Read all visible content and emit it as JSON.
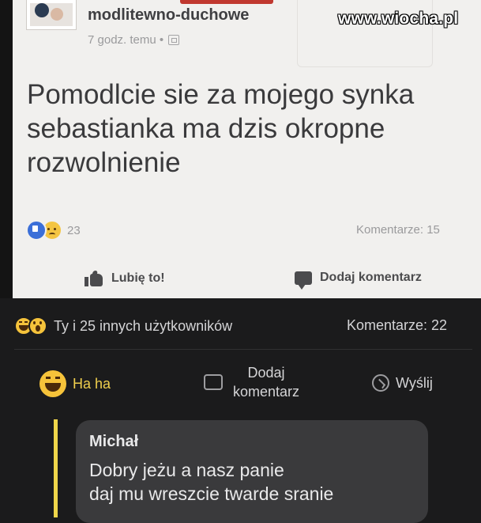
{
  "watermark": "www.wiocha.pl",
  "post": {
    "page_name": "modlitewno-duchowe",
    "time": "7 godz. temu •",
    "text": "Pomodlcie sie za mojego synka sebastianka ma dzis okropne rozwolnienie",
    "reaction_count": "23",
    "comments": "Komentarze: 15",
    "actions": {
      "like": "Lubię to!",
      "comment": "Dodaj komentarz"
    },
    "colors": {
      "like_reaction": "#3b6fd8",
      "sad_reaction": "#f4c542",
      "background": "#f1f0ee"
    }
  },
  "dark_post": {
    "reactions_text": "Ty i 25 innych użytkowników",
    "comments": "Komentarze: 22",
    "actions": {
      "haha": "Ha ha",
      "comment_line1": "Dodaj",
      "comment_line2": "komentarz",
      "send": "Wyślij"
    },
    "comment": {
      "author": "Michał",
      "line1": "Dobry jeżu a nasz panie",
      "line2": "daj mu wreszcie twarde sranie"
    },
    "colors": {
      "accent": "#f0d64a",
      "haha": "#f6c33a",
      "background": "#1b1b1c"
    }
  }
}
